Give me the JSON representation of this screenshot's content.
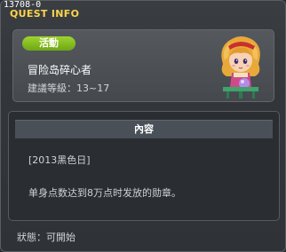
{
  "window": {
    "id_label": "13708-0",
    "title": "QUEST INFO"
  },
  "quest": {
    "badge": "活動",
    "title": "冒险岛碎心者",
    "level": "建議等級：13~17",
    "npc_icon": "npc-portrait-icon"
  },
  "content": {
    "tab_label": "內容",
    "date": "[2013黑色日]",
    "description": "单身点数达到8万点时发放的勋章。"
  },
  "status": {
    "text": "狀態：可開始"
  },
  "colors": {
    "title": "#ffd34a",
    "badge": "#8cc522",
    "panel": "#2a2d31"
  }
}
